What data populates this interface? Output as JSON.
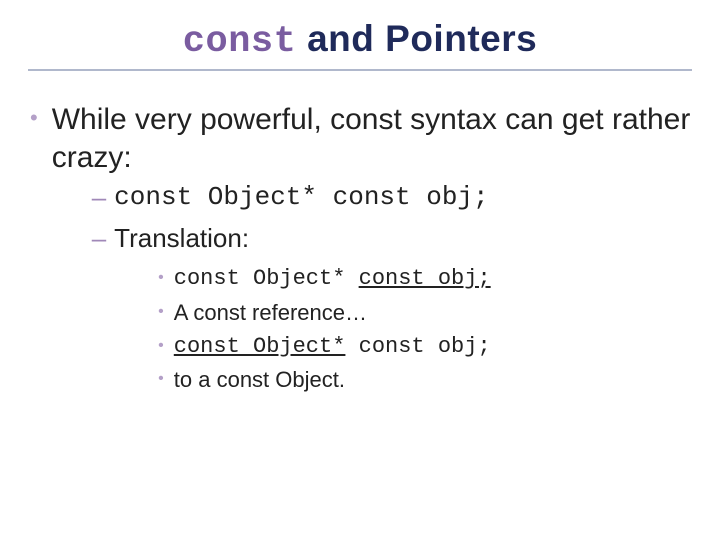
{
  "title": {
    "code_word": "const",
    "rest": " and Pointers"
  },
  "bullet1": {
    "text": "While very powerful, const syntax can get rather crazy:"
  },
  "sub1": {
    "code": "const Object* const obj;"
  },
  "sub2": {
    "text": "Translation:"
  },
  "subsub": [
    {
      "prefix": "const Object* ",
      "emph": "const obj;",
      "suffix": "",
      "is_code": true
    },
    {
      "prefix": "",
      "emph": "",
      "suffix": "A const reference…",
      "is_code": false
    },
    {
      "prefix": "",
      "emph": "const Object*",
      "suffix": " const obj;",
      "is_code": true
    },
    {
      "prefix": "",
      "emph": "",
      "suffix": "to a const Object.",
      "is_code": false
    }
  ]
}
